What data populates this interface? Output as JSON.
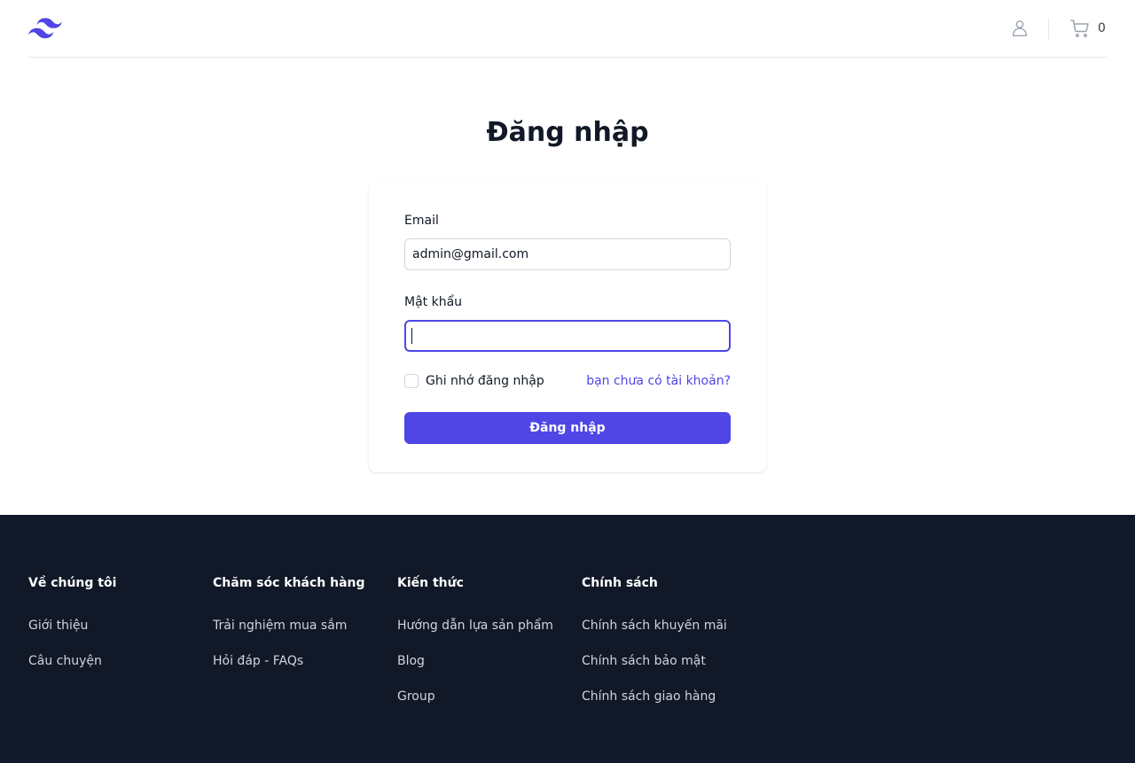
{
  "header": {
    "logo_icon": "tailwind-wave-logo",
    "user_icon": "user-icon",
    "cart_icon": "shopping-cart-icon",
    "cart_count": "0",
    "brand_color": "#4f46e5"
  },
  "login": {
    "title": "Đăng nhập",
    "email_label": "Email",
    "email_value": "admin@gmail.com",
    "password_label": "Mật khẩu",
    "password_value": "",
    "remember_label": "Ghi nhớ đăng nhập",
    "remember_checked": false,
    "register_link": "bạn chưa có tài khoản?",
    "submit_label": "Đăng nhập"
  },
  "footer": {
    "columns": [
      {
        "title": "Về chúng tôi",
        "items": [
          "Giới thiệu",
          "Câu chuyện"
        ]
      },
      {
        "title": "Chăm sóc khách hàng",
        "items": [
          "Trải nghiệm mua sắm",
          "Hỏi đáp - FAQs"
        ]
      },
      {
        "title": "Kiến thức",
        "items": [
          "Hướng dẫn lựa sản phẩm",
          "Blog",
          "Group"
        ]
      },
      {
        "title": "Chính sách",
        "items": [
          "Chính sách khuyến mãi",
          "Chính sách bảo mật",
          "Chính sách giao hàng"
        ]
      }
    ]
  }
}
